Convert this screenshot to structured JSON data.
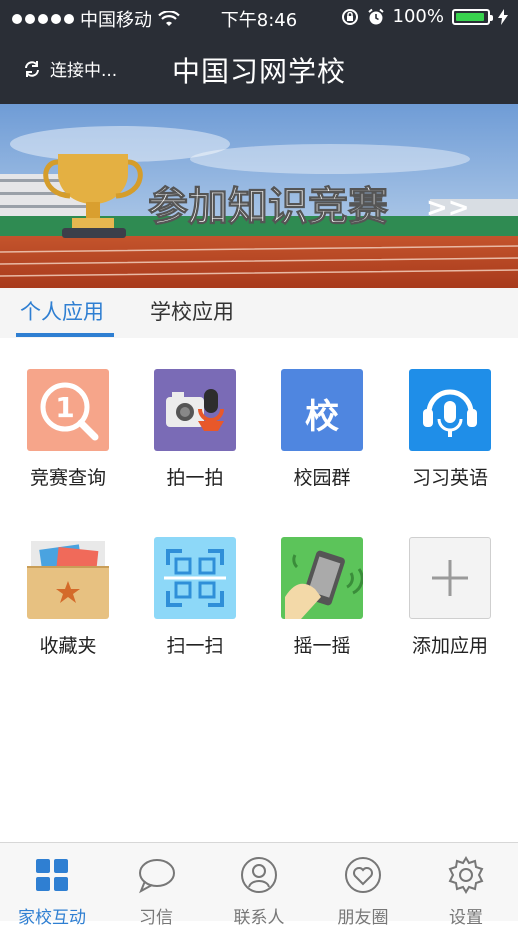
{
  "status_bar": {
    "carrier": "中国移动",
    "time": "下午8:46",
    "battery": "100%"
  },
  "nav": {
    "connection_label": "连接中...",
    "title": "中国习网学校"
  },
  "banner": {
    "text": "参加知识竞赛",
    "arrow": ">>"
  },
  "tabs": [
    {
      "label": "个人应用",
      "active": true
    },
    {
      "label": "学校应用",
      "active": false
    }
  ],
  "apps": [
    {
      "label": "竞赛查询",
      "icon": "contest-query-icon",
      "color": "#f6a58a"
    },
    {
      "label": "拍一拍",
      "icon": "camera-mic-icon",
      "color": "#7a6bb6"
    },
    {
      "label": "校园群",
      "icon": "campus-group-icon",
      "color": "#4f86e0",
      "glyph": "校"
    },
    {
      "label": "习习英语",
      "icon": "headset-icon",
      "color": "#1f8ee8"
    },
    {
      "label": "收藏夹",
      "icon": "favorites-box-icon",
      "color": "#e7c181"
    },
    {
      "label": "扫一扫",
      "icon": "scan-icon",
      "color": "#8dd8f8"
    },
    {
      "label": "摇一摇",
      "icon": "shake-phone-icon",
      "color": "#5cc45a"
    },
    {
      "label": "添加应用",
      "icon": "plus-icon",
      "color": "#f3f3f3"
    }
  ],
  "tabbar": [
    {
      "label": "家校互动",
      "icon": "grid-icon",
      "active": true
    },
    {
      "label": "习信",
      "icon": "chat-bubble-icon",
      "active": false
    },
    {
      "label": "联系人",
      "icon": "person-icon",
      "active": false
    },
    {
      "label": "朋友圈",
      "icon": "heart-icon",
      "active": false
    },
    {
      "label": "设置",
      "icon": "gear-icon",
      "active": false
    }
  ]
}
